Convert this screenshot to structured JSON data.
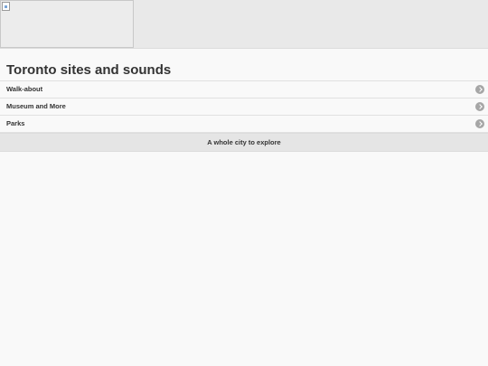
{
  "header": {
    "image_alt": ""
  },
  "page": {
    "title": "Toronto sites and sounds"
  },
  "list": {
    "items": [
      {
        "label": "Walk-about"
      },
      {
        "label": "Museum and More"
      },
      {
        "label": "Parks"
      }
    ]
  },
  "footer": {
    "text": "A whole city to explore"
  }
}
